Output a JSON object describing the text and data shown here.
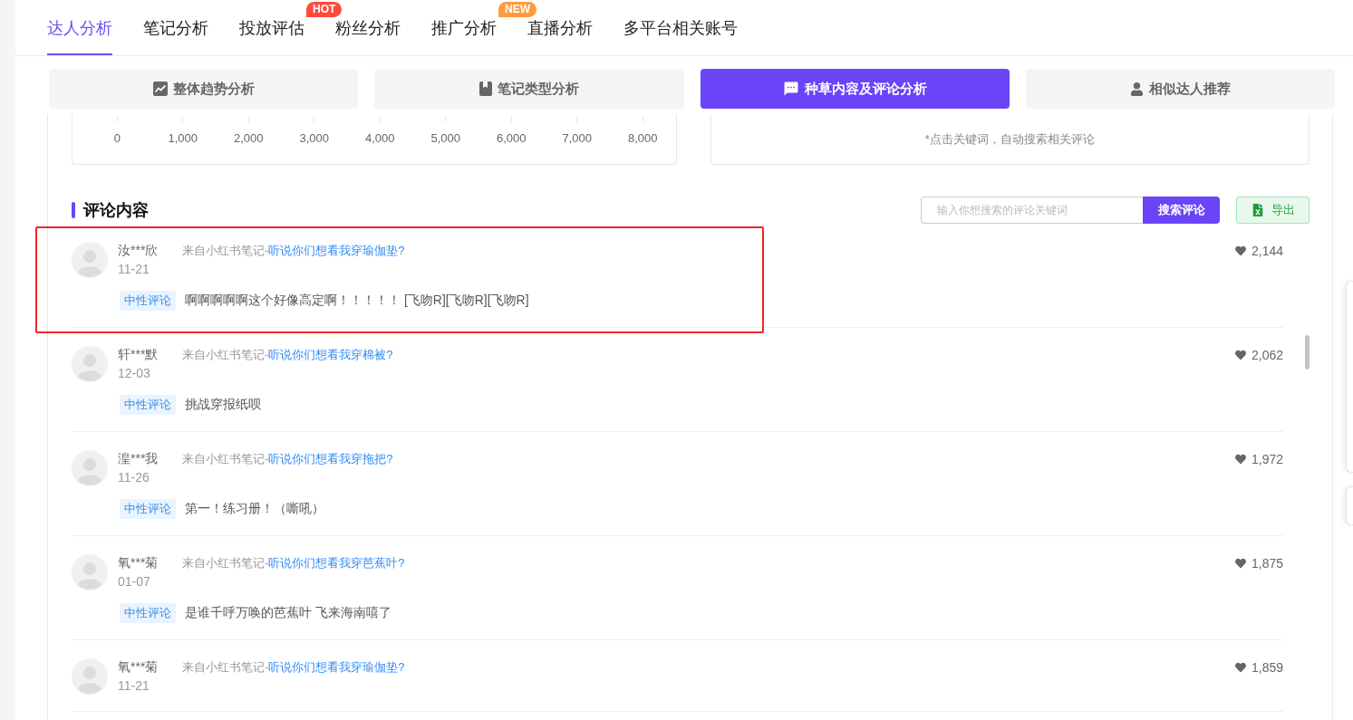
{
  "nav": {
    "tabs": [
      {
        "label": "达人分析",
        "selected": true
      },
      {
        "label": "笔记分析",
        "selected": false
      },
      {
        "label": "投放评估",
        "selected": false,
        "badge": {
          "text": "HOT",
          "color": "#ff4a3d"
        }
      },
      {
        "label": "粉丝分析",
        "selected": false
      },
      {
        "label": "推广分析",
        "selected": false,
        "badge": {
          "text": "NEW",
          "color": "#ff9b3d"
        }
      },
      {
        "label": "直播分析",
        "selected": false
      },
      {
        "label": "多平台相关账号",
        "selected": false
      }
    ]
  },
  "analysis_tabs": [
    {
      "label": "整体趋势分析",
      "kind": "trend",
      "selected": false
    },
    {
      "label": "笔记类型分析",
      "kind": "note",
      "selected": false
    },
    {
      "label": "种草内容及评论分析",
      "kind": "comment",
      "selected": true
    },
    {
      "label": "相似达人推荐",
      "kind": "user",
      "selected": false
    }
  ],
  "chart_panel": {
    "axis_labels": [
      "0",
      "1,000",
      "2,000",
      "3,000",
      "4,000",
      "5,000",
      "6,000",
      "7,000",
      "8,000"
    ]
  },
  "keyword_panel": {
    "hint": "*点击关键词，自动搜索相关评论"
  },
  "comments_section": {
    "title": "评论内容",
    "search": {
      "placeholder": "输入你想搜索的评论关键词",
      "button": "搜索评论"
    },
    "export_button": "导出",
    "comments": [
      {
        "user": "汝***欣",
        "date": "11-21",
        "source_prefix": "来自小红书笔记-",
        "note_title": "听说你们想看我穿瑜伽垫?",
        "likes": "2,144",
        "sentiment": "中性评论",
        "text": "啊啊啊啊啊这个好像高定啊！！！！！ [飞吻R][飞吻R][飞吻R]",
        "highlighted": true
      },
      {
        "user": "轩***默",
        "date": "12-03",
        "source_prefix": "来自小红书笔记-",
        "note_title": "听说你们想看我穿棉被?",
        "likes": "2,062",
        "sentiment": "中性评论",
        "text": "挑战穿报纸呗",
        "highlighted": false
      },
      {
        "user": "湟***我",
        "date": "11-26",
        "source_prefix": "来自小红书笔记-",
        "note_title": "听说你们想看我穿拖把?",
        "likes": "1,972",
        "sentiment": "中性评论",
        "text": "第一！练习册！（嘶吼）",
        "highlighted": false
      },
      {
        "user": "氧***菊",
        "date": "01-07",
        "source_prefix": "来自小红书笔记-",
        "note_title": "听说你们想看我穿芭蕉叶?",
        "likes": "1,875",
        "sentiment": "中性评论",
        "text": "是谁千呼万唤的芭蕉叶 飞来海南嘻了",
        "highlighted": false
      },
      {
        "user": "氧***菊",
        "date": "11-21",
        "source_prefix": "来自小红书笔记-",
        "note_title": "听说你们想看我穿瑜伽垫?",
        "likes": "1,859",
        "highlighted": false
      }
    ]
  }
}
